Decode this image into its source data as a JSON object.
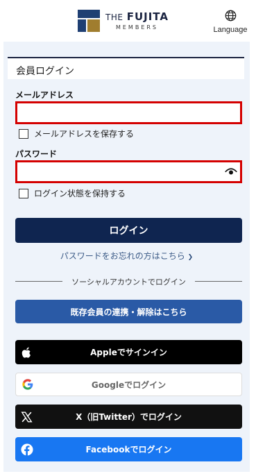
{
  "header": {
    "brand_the": "THE",
    "brand_name": "FUJITA",
    "brand_sub": "MEMBERS",
    "language_label": "Language"
  },
  "form": {
    "title": "会員ログイン",
    "email_label": "メールアドレス",
    "email_value": "",
    "save_email_label": "メールアドレスを保存する",
    "password_label": "パスワード",
    "password_value": "",
    "keep_login_label": "ログイン状態を保持する",
    "login_button": "ログイン",
    "forgot_link": "パスワードをお忘れの方はこちら",
    "forgot_chevron": "❯"
  },
  "social": {
    "divider_text": "ソーシャルアカウントでログイン",
    "link_existing": "既存会員の連携・解除はこちら",
    "apple": "Appleでサインイン",
    "google": "Googleでログイン",
    "x": "X（旧Twitter）でログイン",
    "facebook": "Facebookでログイン"
  },
  "colors": {
    "navy": "#0f2550",
    "link_blue": "#2a5aa6",
    "error_red": "#d40000",
    "facebook_blue": "#1877f2",
    "panel_bg": "#eef3fa"
  },
  "icons": [
    "globe-icon",
    "eye-icon",
    "apple-icon",
    "google-icon",
    "x-icon",
    "facebook-icon"
  ]
}
